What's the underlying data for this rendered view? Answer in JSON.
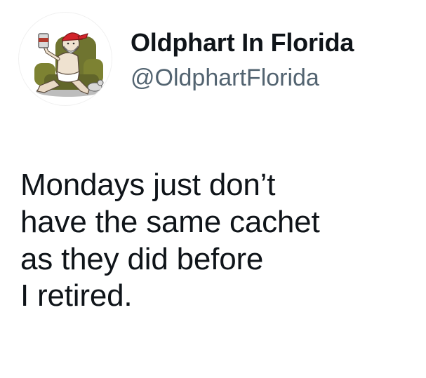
{
  "author": {
    "display_name": "Oldphart In Florida",
    "handle": "@OldphartFlorida",
    "avatar_icon": "old-man-in-armchair-cartoon-avatar"
  },
  "tweet": {
    "lines": [
      "Mondays just don’t",
      "have the same cachet",
      "as they did before",
      "I retired."
    ]
  },
  "colors": {
    "text": "#0f1419",
    "handle": "#536471",
    "background": "#ffffff"
  }
}
